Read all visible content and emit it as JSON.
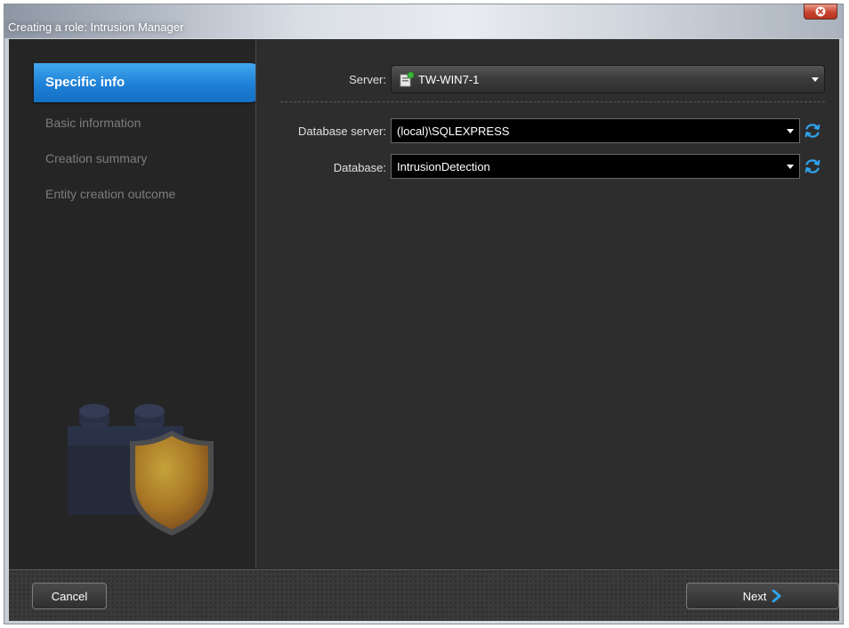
{
  "window": {
    "title": "Creating a role: Intrusion Manager"
  },
  "sidebar": {
    "items": [
      {
        "label": "Specific info",
        "active": true
      },
      {
        "label": "Basic information",
        "active": false
      },
      {
        "label": "Creation summary",
        "active": false
      },
      {
        "label": "Entity creation outcome",
        "active": false
      }
    ],
    "illustration_icons": [
      "lego-brick-icon",
      "shield-icon"
    ]
  },
  "form": {
    "server_label": "Server:",
    "server_value": "TW-WIN7-1",
    "server_icon": "server-icon",
    "database_server_label": "Database server:",
    "database_server_value": "(local)\\SQLEXPRESS",
    "database_label": "Database:",
    "database_value": "IntrusionDetection"
  },
  "footer": {
    "cancel_label": "Cancel",
    "next_label": "Next"
  },
  "colors": {
    "accent": "#1e80d6",
    "refresh": "#2fa3ef",
    "close": "#c7432d"
  }
}
